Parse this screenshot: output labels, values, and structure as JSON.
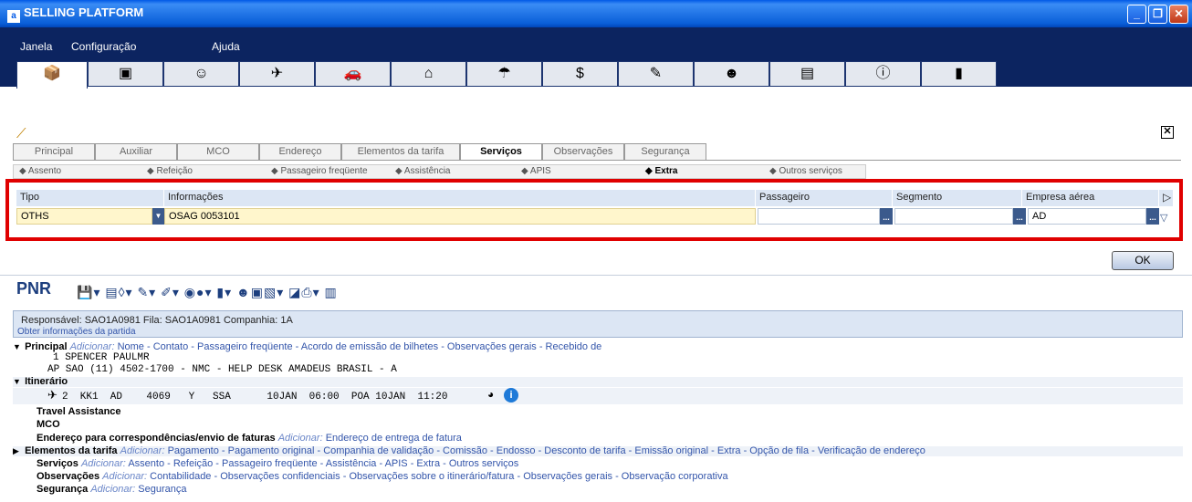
{
  "window": {
    "title": "SELLING PLATFORM",
    "app_icon": "a",
    "controls": [
      "_",
      "❐",
      "✕"
    ]
  },
  "menu": {
    "items": [
      "Janela",
      "Configuração",
      "Ajuda"
    ]
  },
  "icon_tabs": [
    "suitcase-icon",
    "terminal-icon",
    "person-icon",
    "car-icon",
    "taxi-icon",
    "hotel-icon",
    "umbrella-icon",
    "money-icon",
    "edit-icon",
    "agent-icon",
    "document-icon",
    "info-icon",
    "chart-icon"
  ],
  "tabs": [
    "Principal",
    "Auxiliar",
    "MCO",
    "Endereço",
    "Elementos da tarifa",
    "Serviços",
    "Observações",
    "Segurança"
  ],
  "active_tab": "Serviços",
  "subtabs": [
    "Assento",
    "Refeição",
    "Passageiro freqüente",
    "Assistência",
    "APIS",
    "Extra",
    "Outros serviços"
  ],
  "form": {
    "headers": {
      "tipo": "Tipo",
      "info": "Informações",
      "passageiro": "Passageiro",
      "segmento": "Segmento",
      "empresa": "Empresa aérea"
    },
    "values": {
      "tipo": "OTHS",
      "info": "OSAG 0053101",
      "passageiro": "",
      "segmento": "",
      "empresa": "AD"
    }
  },
  "ok_label": "OK",
  "pnr": {
    "title": "PNR",
    "info_line": "Responsável: SAO1A0981       Fila: SAO1A0981    Companhia: 1A",
    "info_link": "Obter informações da partida",
    "principal": {
      "title": "Principal",
      "add_label": "Adicionar:",
      "links": "Nome - Contato - Passageiro freqüente - Acordo de emissão de bilhetes - Observações gerais - Recebido de",
      "line1": "1 SPENCER PAULMR",
      "line2": "AP SAO (11) 4502-1700 - NMC - HELP DESK AMADEUS BRASIL - A"
    },
    "itinerario": {
      "title": "Itinerário",
      "line": "2  KK1  AD    4069   Y   SSA      10JAN  06:00  POA 10JAN  11:20"
    },
    "travel": "Travel Assistance",
    "mco": "MCO",
    "endereco": {
      "title": "Endereço para correspondências/envio de faturas",
      "add_label": "Adicionar:",
      "links": "Endereço de entrega de fatura"
    },
    "elementos": {
      "title": "Elementos da tarifa",
      "add_label": "Adicionar:",
      "links": "Pagamento - Pagamento original - Companhia de validação - Comissão - Endosso - Desconto de tarifa - Emissão original - Extra - Opção de fila - Verificação de endereço"
    },
    "servicos": {
      "title": "Serviços",
      "add_label": "Adicionar:",
      "links": "Assento - Refeição - Passageiro freqüente - Assistência - APIS - Extra - Outros serviços"
    },
    "observacoes": {
      "title": "Observações",
      "add_label": "Adicionar:",
      "links": "Contabilidade - Observações confidenciais - Observações sobre o itinerário/fatura - Observações gerais - Observação corporativa"
    },
    "seguranca": {
      "title": "Segurança",
      "add_label": "Adicionar:",
      "links": "Segurança"
    }
  },
  "colors": {
    "title_bar": "#0a5fd8",
    "menu_bg": "#0c2460",
    "highlight": "#e00000",
    "field_yellow": "#fff6cc"
  }
}
